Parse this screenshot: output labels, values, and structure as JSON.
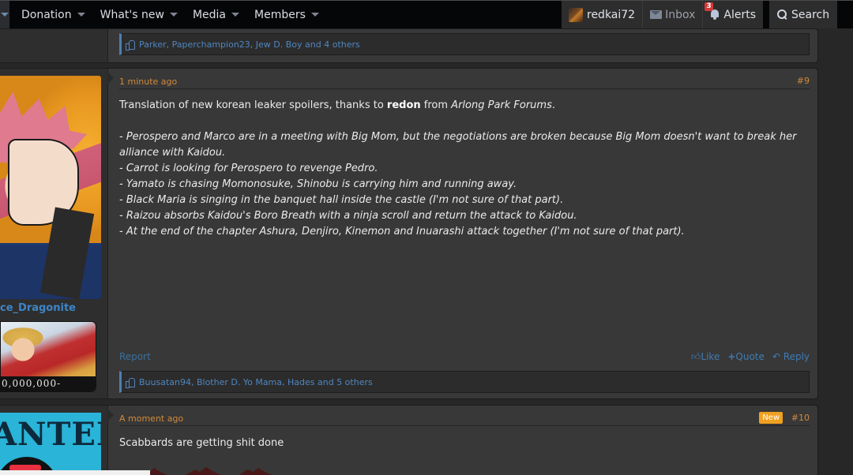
{
  "nav": {
    "items": [
      {
        "label": "Donation"
      },
      {
        "label": "What's new"
      },
      {
        "label": "Media"
      },
      {
        "label": "Members"
      }
    ],
    "user": {
      "name": "redkai72"
    },
    "inbox": {
      "label": "Inbox"
    },
    "alerts": {
      "label": "Alerts",
      "count": "3"
    },
    "search": {
      "label": "Search"
    }
  },
  "prev_post": {
    "reactions": "Parker, Paperchampion23, Jew D. Boy and 4 others"
  },
  "post9": {
    "author": "ce_Dragonite",
    "bounty": "0,000,000-",
    "time": "1 minute ago",
    "number": "#9",
    "intro_pre": "Translation of new korean leaker spoilers, thanks to ",
    "intro_bold": "redon",
    "intro_mid": " from ",
    "intro_italic": "Arlong Park Forums",
    "intro_end": ".",
    "lines": [
      "- Perospero and Marco are in a meeting with Big Mom, but the negotiations are broken because Big Mom doesn't want to break her alliance with Kaidou.",
      "- Carrot is looking for Perospero to revenge Pedro.",
      "- Yamato is chasing Momonosuke, Shinobu is carrying him and running away.",
      "- Black Maria is singing in the banquet hall inside the castle (I'm not sure of that part).",
      "- Raizou absorbs Kaidou's Boro Breath with a ninja scroll and return the attack to Kaidou.",
      "- At the end of the chapter Ashura, Denjiro, Kinemon and Inuarashi attack together (I'm not sure of that part)."
    ],
    "report": "Report",
    "like": "Like",
    "quote": "Quote",
    "reply": "Reply",
    "reactions": "Buusatan94, Blother D. Yo Mama, Hades and 5 others"
  },
  "post10": {
    "avatar_text": "ANTED",
    "time": "A moment ago",
    "badge": "New",
    "number": "#10",
    "body": "Scabbards are getting shit done"
  },
  "colors": {
    "accent_blue": "#3e85c6",
    "meta_orange": "#d28a3a",
    "new_badge": "#f0a020",
    "alert_red": "#d23a3a"
  }
}
